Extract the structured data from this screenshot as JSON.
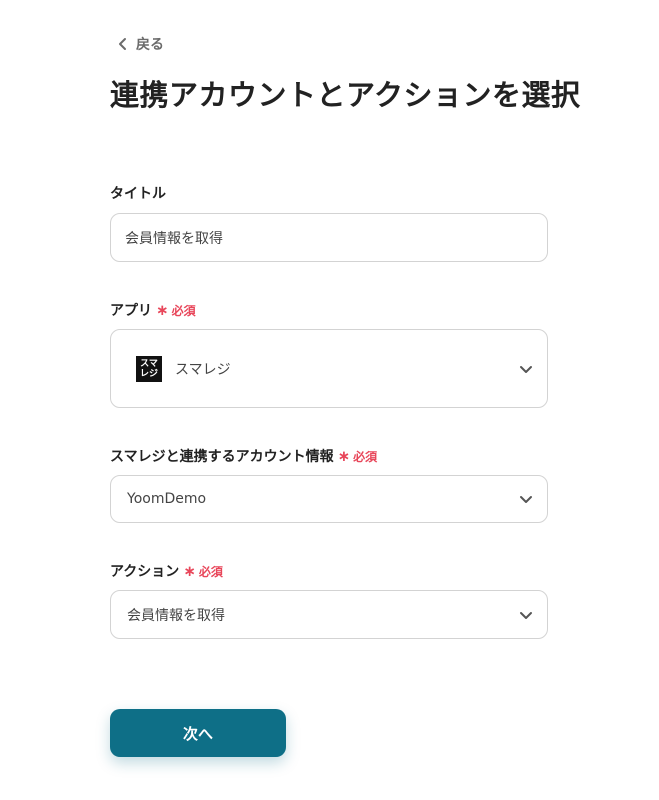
{
  "nav": {
    "back_label": "戻る"
  },
  "page": {
    "title": "連携アカウントとアクションを選択"
  },
  "required_label": "必須",
  "fields": {
    "title": {
      "label": "タイトル",
      "value": "会員情報を取得"
    },
    "app": {
      "label": "アプリ",
      "value": "スマレジ",
      "logo_line1": "スマ",
      "logo_line2": "レジ"
    },
    "account": {
      "label": "スマレジと連携するアカウント情報",
      "value": "YoomDemo"
    },
    "action": {
      "label": "アクション",
      "value": "会員情報を取得"
    }
  },
  "buttons": {
    "next_label": "次へ"
  },
  "colors": {
    "accent": "#0e6f87",
    "required": "#e8465a"
  }
}
